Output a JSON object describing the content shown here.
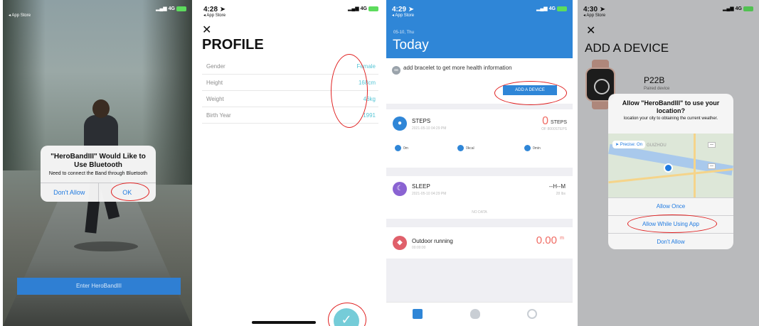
{
  "screen1": {
    "status": {
      "time": "",
      "back_label": "App Store",
      "network": "4G"
    },
    "alert": {
      "title": "\"HeroBandIII\" Would Like to Use Bluetooth",
      "message": "Need to connect the Band through Bluetooth",
      "deny_label": "Don't Allow",
      "ok_label": "OK"
    },
    "enter_button": "Enter HeroBandIII"
  },
  "screen2": {
    "status": {
      "time": "4:28",
      "back_label": "App Store",
      "network": "4G"
    },
    "title": "PROFILE",
    "fields": [
      {
        "label": "Gender",
        "value": "Female"
      },
      {
        "label": "Height",
        "value": "168cm"
      },
      {
        "label": "Weight",
        "value": "46kg"
      },
      {
        "label": "Birth Year",
        "value": "1991"
      }
    ]
  },
  "screen3": {
    "status": {
      "time": "4:29",
      "back_label": "App Store",
      "network": "4G"
    },
    "date": "05-10, Thu",
    "title": "Today",
    "add_text": "add bracelet to get more health information",
    "add_button": "ADD A DEVICE",
    "steps": {
      "title": "STEPS",
      "time": "2021-05-10 04:29 PM",
      "value": "0",
      "unit": "STEPS",
      "goal": "OF 8000STEPS",
      "metrics": [
        "0m",
        "0kcal",
        "0min"
      ]
    },
    "sleep": {
      "title": "SLEEP",
      "time": "2021-05-10 04:29 PM",
      "value": "--H--M",
      "sub": "28 lbs",
      "empty": "NO DATA"
    },
    "running": {
      "title": "Outdoor running",
      "sub": "00:00:00",
      "value": "0.00",
      "unit": "m"
    }
  },
  "screen4": {
    "status": {
      "time": "4:30",
      "back_label": "App Store",
      "network": "4G"
    },
    "title": "ADD A DEVICE",
    "device": {
      "name": "P22B",
      "status": "Paired device"
    },
    "alert": {
      "title": "Allow \"HeroBandIII\" to use your location?",
      "message": "location your city to obtaining the current weather.",
      "precise_label": "Precise: On",
      "map_place": "GUIZHOU",
      "options": [
        "Allow Once",
        "Allow While Using App",
        "Don't Allow"
      ]
    }
  },
  "colors": {
    "accent": "#2f86d7",
    "highlight": "#e02020",
    "value": "#57c6d6",
    "alert_value": "#f06b63"
  }
}
